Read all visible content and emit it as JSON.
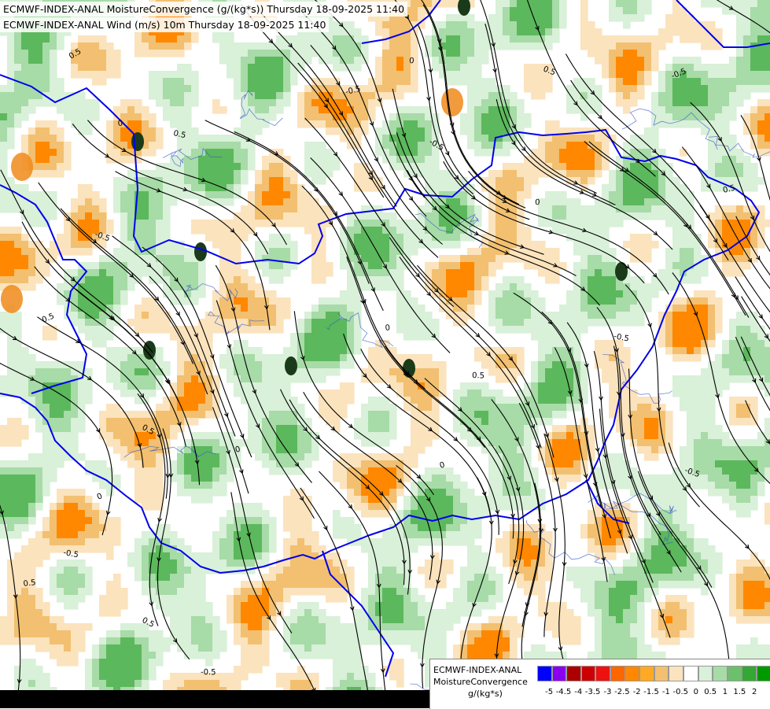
{
  "titles": {
    "line1": "ECMWF-INDEX-ANAL MoistureConvergence (g/(kg*s)) Thursday 18-09-2025 11:40",
    "line2": "ECMWF-INDEX-ANAL Wind (m/s) 10m Thursday 18-09-2025 11:40"
  },
  "legend": {
    "line1": "ECMWF-INDEX-ANAL",
    "line2": "MoistureConvergence",
    "unit": "g/(kg*s)",
    "colors": [
      "#0000ff",
      "#8800ee",
      "#aa0000",
      "#cc0000",
      "#ee1111",
      "#ff6600",
      "#ff8800",
      "#ffaa22",
      "#f2c070",
      "#fbe3bd",
      "#ffffff",
      "#d9f0d9",
      "#a7dba7",
      "#6cc06c",
      "#33a833",
      "#009900"
    ],
    "tick_labels": [
      "-5",
      "-4.5",
      "-4",
      "-3.5",
      "-3",
      "-2.5",
      "-2",
      "-1.5",
      "-1",
      "-0.5",
      "0",
      "0.5",
      "1",
      "1.5",
      "2"
    ]
  },
  "map": {
    "contour_labels": [
      "0.5",
      "-0.5",
      "0",
      "0.5",
      "-0.5",
      "0",
      "0.5",
      "-0.5",
      "0.5",
      "0",
      "-0.5",
      "0.5",
      "0",
      "-0.5",
      "0.5",
      "0",
      "0.5",
      "-0.5",
      "0",
      "0.5",
      "-0.5",
      "0.5",
      "0",
      "-0.5"
    ],
    "colors": {
      "border": "#0000ee",
      "river": "#3355cc",
      "streamline": "#000000",
      "positive_light": "#d9f0d9",
      "positive_mid": "#a7dba7",
      "positive_strong": "#5cb85c",
      "negative_light": "#fbe3bd",
      "negative_mid": "#f2c070",
      "negative_strong": "#ff8800"
    }
  }
}
